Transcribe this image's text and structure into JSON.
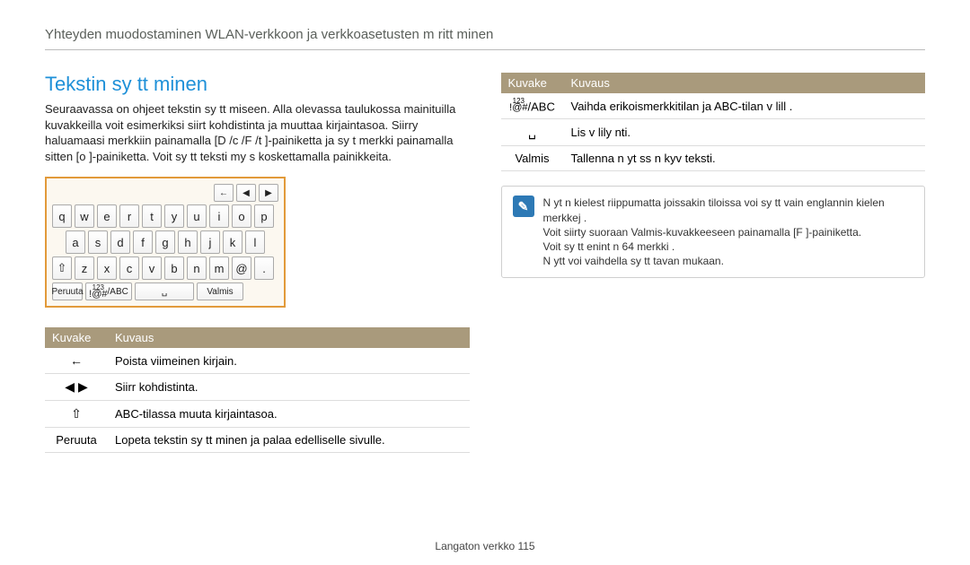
{
  "header": "Yhteyden muodostaminen WLAN-verkkoon ja verkkoasetusten m  ritt minen",
  "section_title": "Tekstin sy tt minen",
  "intro": "Seuraavassa on ohjeet tekstin sy tt miseen. Alla olevassa taulukossa mainituilla kuvakkeilla voit esimerkiksi siirt   kohdistinta ja muuttaa kirjaintasoa. Siirry haluamaasi merkkiin painamalla [D  /c  /F /t  ]-painiketta ja sy t  merkki painamalla sitten [o  ]-painiketta. Voit sy tt   teksti  my s koskettamalla painikkeita.",
  "keyboard": {
    "toprow": [
      "←",
      "◀",
      "▶"
    ],
    "row1": [
      "q",
      "w",
      "e",
      "r",
      "t",
      "y",
      "u",
      "i",
      "o",
      "p"
    ],
    "row2": [
      "a",
      "s",
      "d",
      "f",
      "g",
      "h",
      "j",
      "k",
      "l"
    ],
    "row3_shift": "⇧",
    "row3": [
      "z",
      "x",
      "c",
      "v",
      "b",
      "n",
      "m",
      "@",
      "."
    ],
    "row4": {
      "cancel": "Peruuta",
      "mode_top": "123",
      "mode_bot": "!@#",
      "mode_right": "/ABC",
      "space": "␣",
      "done": "Valmis"
    }
  },
  "table_left": {
    "col1": "Kuvake",
    "col2": "Kuvaus",
    "rows": [
      {
        "icon": "←",
        "desc": "Poista viimeinen kirjain."
      },
      {
        "icon": "◀ ▶",
        "desc": "Siirr  kohdistinta."
      },
      {
        "icon": "⇧",
        "desc": "ABC-tilassa muuta kirjaintasoa."
      },
      {
        "icon": "Peruuta",
        "desc": "Lopeta tekstin sy tt minen ja palaa edelliselle sivulle."
      }
    ]
  },
  "table_right": {
    "col1": "Kuvake",
    "col2": "Kuvaus",
    "rows": [
      {
        "icon_top": "123",
        "icon_bot": "!@#",
        "icon_right": "/ABC",
        "desc": "Vaihda erikoismerkkitilan ja ABC-tilan v lill ."
      },
      {
        "icon": "␣",
        "desc": "Lis   v lily nti."
      },
      {
        "icon": "Valmis",
        "desc": "Tallenna n yt ss  n kyv  teksti."
      }
    ]
  },
  "note": {
    "lines": [
      "N yt n kielest  riippumatta joissakin tiloissa voi sy tt   vain englannin kielen merkkej .",
      "Voit siirty  suoraan Valmis-kuvakkeeseen painamalla [F ]-painiketta.",
      "Voit sy tt   enint  n 64 merkki .",
      "N ytt  voi vaihdella sy tt tavan mukaan."
    ]
  },
  "footer_label": "Langaton verkko",
  "footer_page": "115"
}
